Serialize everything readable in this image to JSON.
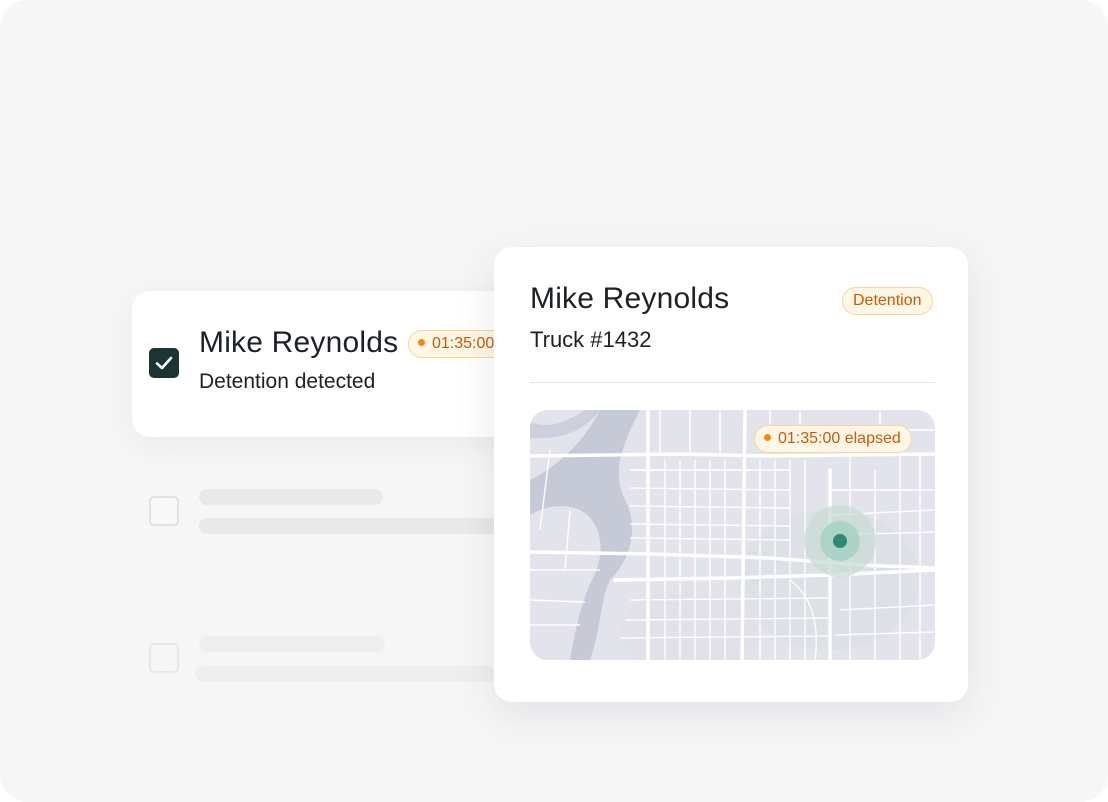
{
  "list": {
    "selected_item": {
      "checked": true,
      "name": "Mike Reynolds",
      "subtitle": "Detention detected",
      "timer": "01:35:00"
    }
  },
  "detail": {
    "name": "Mike Reynolds",
    "truck": "Truck #1432",
    "status_badge": "Detention",
    "map": {
      "elapsed_label": "01:35:00 elapsed",
      "marker_icon": "location-dot-icon"
    }
  },
  "colors": {
    "background": "#f7f6f7",
    "checkbox_checked": "#1c3434",
    "badge_text": "#c25d0a",
    "badge_bg": "#fff6e6",
    "badge_border": "#f7d69a",
    "status_dot": "#f08a10",
    "map_marker": "#2e8a72"
  }
}
